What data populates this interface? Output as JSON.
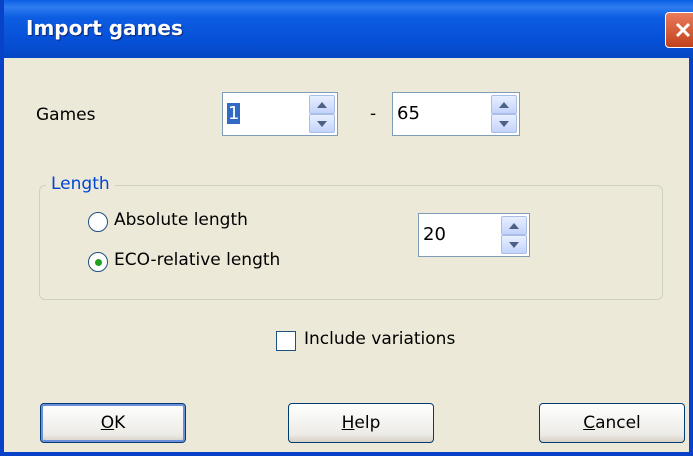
{
  "window": {
    "title": "Import games",
    "close_icon": "close-icon"
  },
  "games": {
    "label": "Games",
    "from_value": "1",
    "separator": "-",
    "to_value": "65"
  },
  "length": {
    "legend": "Length",
    "absolute_label": "Absolute length",
    "eco_label": "ECO-relative length",
    "selected": "eco",
    "value": "20"
  },
  "options": {
    "include_variations_label": "Include variations",
    "include_variations_checked": false
  },
  "buttons": {
    "ok_mnemonic": "O",
    "ok_rest": "K",
    "help_mnemonic": "H",
    "help_rest": "elp",
    "cancel_mnemonic": "C",
    "cancel_rest": "ancel"
  },
  "colors": {
    "titlebar": "#0650d6",
    "legend_text": "#0046d5",
    "radio_dot": "#21a121"
  }
}
